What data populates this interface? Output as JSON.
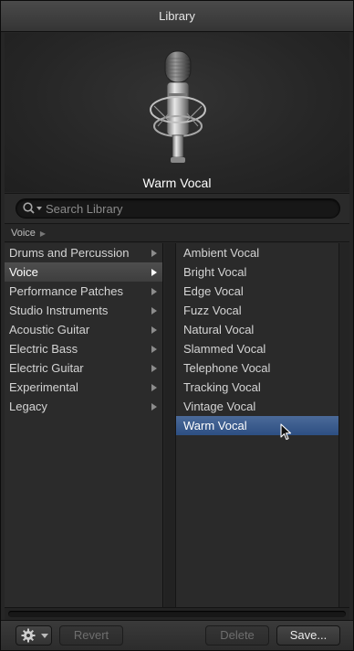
{
  "window": {
    "title": "Library"
  },
  "preview": {
    "preset_name": "Warm Vocal",
    "image_icon": "condenser-microphone"
  },
  "search": {
    "placeholder": "Search Library",
    "value": "",
    "icon": "search-icon"
  },
  "breadcrumb": {
    "path": [
      "Voice"
    ]
  },
  "categories": [
    {
      "label": "Drums and Percussion",
      "has_children": true,
      "selected": false
    },
    {
      "label": "Voice",
      "has_children": true,
      "selected": true
    },
    {
      "label": "Performance Patches",
      "has_children": true,
      "selected": false
    },
    {
      "label": "Studio Instruments",
      "has_children": true,
      "selected": false
    },
    {
      "label": "Acoustic Guitar",
      "has_children": true,
      "selected": false
    },
    {
      "label": "Electric Bass",
      "has_children": true,
      "selected": false
    },
    {
      "label": "Electric Guitar",
      "has_children": true,
      "selected": false
    },
    {
      "label": "Experimental",
      "has_children": true,
      "selected": false
    },
    {
      "label": "Legacy",
      "has_children": true,
      "selected": false
    }
  ],
  "patches": [
    {
      "label": "Ambient Vocal",
      "selected": false
    },
    {
      "label": "Bright Vocal",
      "selected": false
    },
    {
      "label": "Edge Vocal",
      "selected": false
    },
    {
      "label": "Fuzz Vocal",
      "selected": false
    },
    {
      "label": "Natural Vocal",
      "selected": false
    },
    {
      "label": "Slammed Vocal",
      "selected": false
    },
    {
      "label": "Telephone Vocal",
      "selected": false
    },
    {
      "label": "Tracking Vocal",
      "selected": false
    },
    {
      "label": "Vintage Vocal",
      "selected": false
    },
    {
      "label": "Warm Vocal",
      "selected": true
    }
  ],
  "footer": {
    "action_menu_icon": "gear-icon",
    "revert_label": "Revert",
    "revert_enabled": false,
    "delete_label": "Delete",
    "delete_enabled": false,
    "save_label": "Save..."
  },
  "colors": {
    "selection_blue": "#34578c",
    "selection_gray": "#474747",
    "panel_bg": "#262626"
  }
}
